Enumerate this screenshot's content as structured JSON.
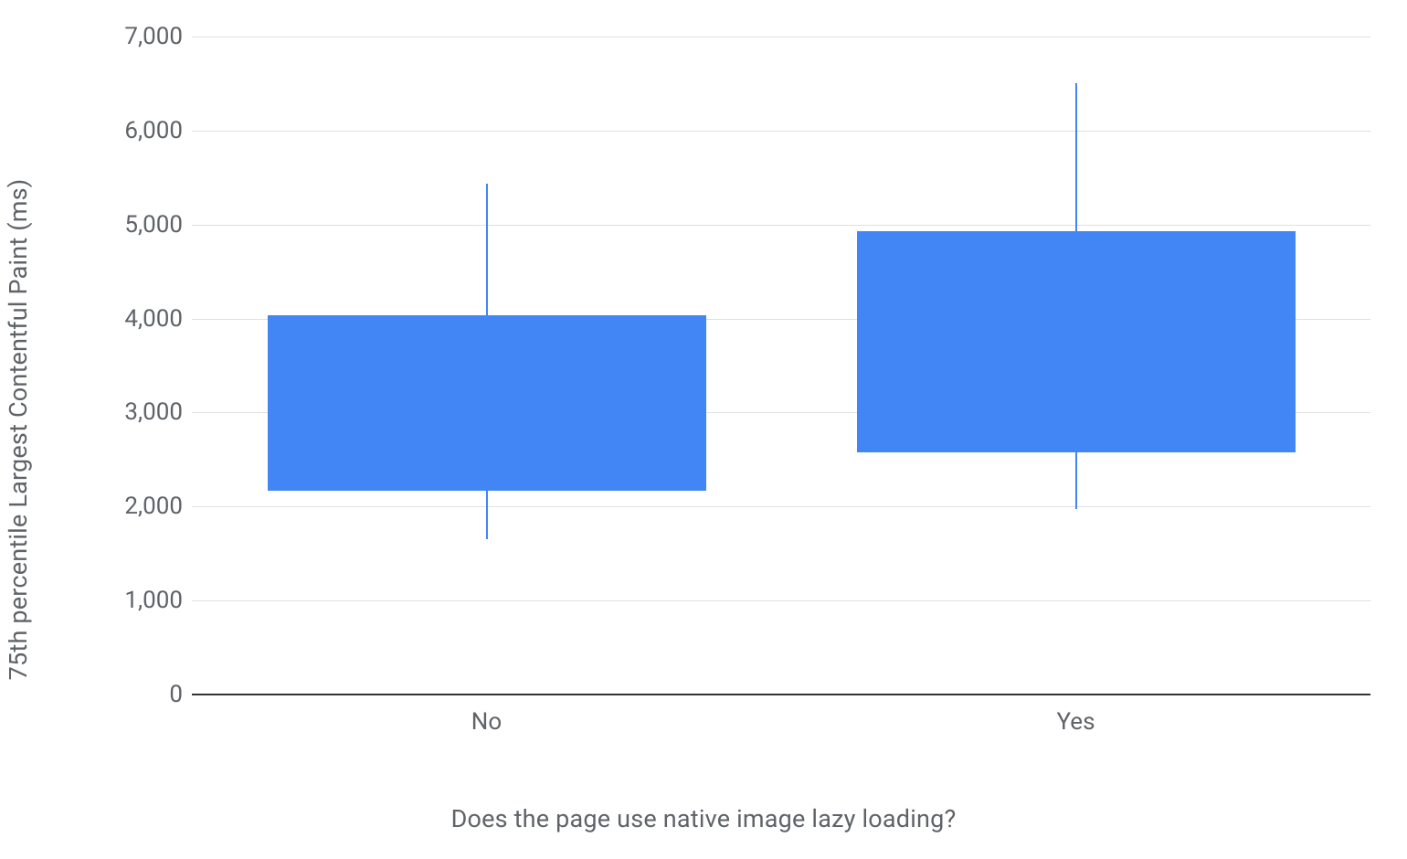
{
  "chart_data": {
    "type": "boxplot",
    "ylabel": "75th percentile Largest Contentful Paint (ms)",
    "xlabel": "Does the page use native image lazy loading?",
    "ylim": [
      0,
      7000
    ],
    "y_ticks": [
      0,
      1000,
      2000,
      3000,
      4000,
      5000,
      6000,
      7000
    ],
    "y_tick_labels": [
      "0",
      "1,000",
      "2,000",
      "3,000",
      "4,000",
      "5,000",
      "6,000",
      "7,000"
    ],
    "categories": [
      "No",
      "Yes"
    ],
    "box_color": "#4285f4",
    "series": [
      {
        "name": "No",
        "whisker_low": 1650,
        "q1": 2170,
        "q3": 4030,
        "whisker_high": 5430
      },
      {
        "name": "Yes",
        "whisker_low": 1970,
        "q1": 2580,
        "q3": 4930,
        "whisker_high": 6500
      }
    ]
  }
}
